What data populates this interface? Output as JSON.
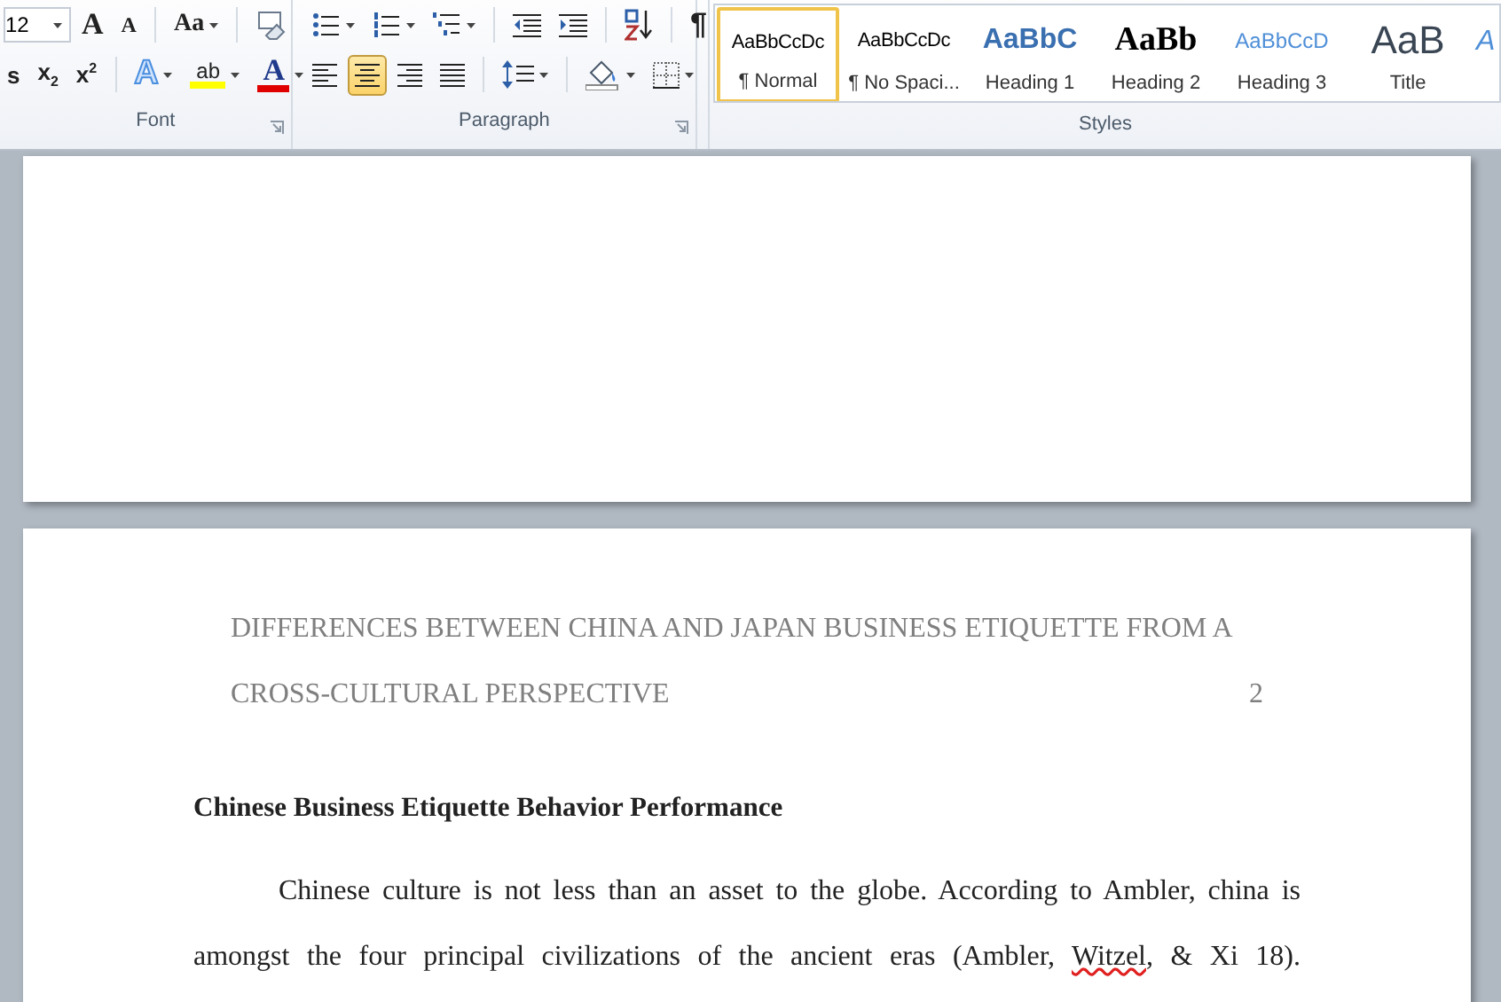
{
  "ribbon": {
    "font": {
      "label": "Font",
      "font_size": "12",
      "grow_font": "A",
      "shrink_font": "A",
      "change_case": "Aa",
      "strikethrough": "s",
      "subscript": "x$_{2}$",
      "superscript": "x$^{2}$",
      "text_effects": "A",
      "highlight": "ab",
      "font_color": "A"
    },
    "paragraph": {
      "label": "Paragraph",
      "show_hide": "¶",
      "alignment": [
        {
          "selected": false
        },
        {
          "selected": true
        },
        {
          "selected": false
        },
        {
          "selected": false
        }
      ]
    },
    "styles": {
      "label": "Styles",
      "gallery": [
        {
          "kind": "normal",
          "preview": "AaBbCcDc",
          "name": "¶ Normal",
          "selected": true
        },
        {
          "kind": "normal",
          "preview": "AaBbCcDc",
          "name": "¶ No Spaci...",
          "selected": false
        },
        {
          "kind": "heading1",
          "preview": "AaBbC",
          "name": "Heading 1",
          "selected": false
        },
        {
          "kind": "heading2",
          "preview": "AaBb",
          "name": "Heading 2",
          "selected": false
        },
        {
          "kind": "heading3",
          "preview": "AaBbCcD",
          "name": "Heading 3",
          "selected": false
        },
        {
          "kind": "title",
          "preview": "AaB",
          "name": "Title",
          "selected": false
        }
      ],
      "more_preview": "A"
    }
  },
  "document": {
    "page_2": {
      "header_lines": [
        "DIFFERENCES BETWEEN CHINA AND JAPAN BUSINESS ETIQUETTE FROM A",
        "CROSS-CULTURAL PERSPECTIVE"
      ],
      "page_number": "2",
      "heading": "Chinese Business Etiquette Behavior Performance",
      "paragraph_lines": [
        [
          {
            "text": "Chinese culture is not less than an asset to the globe.  According to Ambler, china is",
            "misspelled": false
          }
        ],
        [
          {
            "text": "amongst the four principal civilizations of the ancient eras (Ambler, ",
            "misspelled": false
          },
          {
            "text": "Witzel",
            "misspelled": true
          },
          {
            "text": ", & Xi 18).",
            "misspelled": false
          }
        ]
      ]
    }
  }
}
